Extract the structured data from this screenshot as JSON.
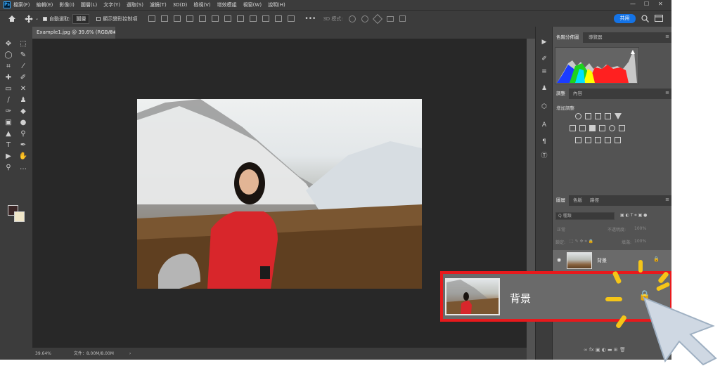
{
  "app": {
    "logo": "Ps"
  },
  "menu": [
    "檔案(F)",
    "編輯(E)",
    "影像(I)",
    "圖層(L)",
    "文字(Y)",
    "選取(S)",
    "濾鏡(T)",
    "3D(D)",
    "檢視(V)",
    "增效模組",
    "視窗(W)",
    "說明(H)"
  ],
  "window_controls": {
    "minimize": "—",
    "restore": "☐",
    "close": "✕"
  },
  "options": {
    "home_icon": "home-icon",
    "auto_select_label": "自動選取:",
    "auto_select_value": "圖層",
    "transform_label": "顯示變形控制項",
    "more": "•••",
    "mode_3d": "3D 模式:",
    "share": "共用"
  },
  "document": {
    "tab_title": "Example1.jpg @ 39.6% (RGB/8#)",
    "close": "×",
    "zoom": "39.64%",
    "file_info": "文件：8.00M/8.00M"
  },
  "panels": {
    "top_tabs": [
      "色階分佈圖",
      "導覽器"
    ],
    "adjust_tabs": [
      "調整",
      "內容"
    ],
    "adjust_title": "增加調整",
    "layer_tabs": [
      "圖層",
      "色版",
      "路徑"
    ],
    "search_placeholder": "Q 種類",
    "blend_mode": "正常",
    "opacity_label": "不透明度:",
    "opacity_value": "100%",
    "lock_label": "鎖定:",
    "fill_label": "填滿:",
    "fill_value": "100%",
    "layer_name": "背景",
    "warning_icon": "▲"
  },
  "callout": {
    "layer_name": "背景",
    "accent": "#e8191c",
    "ray_color": "#f5c518"
  }
}
